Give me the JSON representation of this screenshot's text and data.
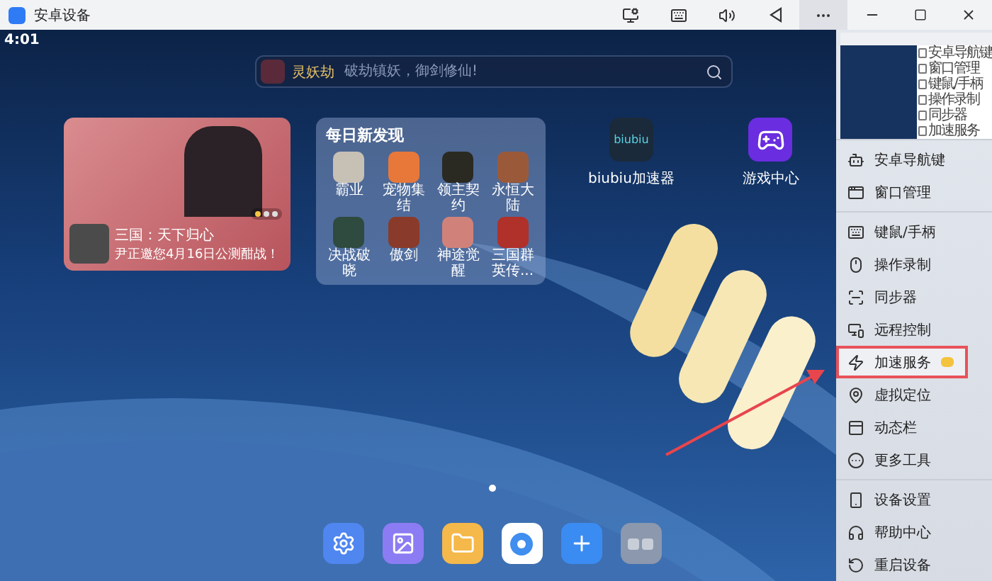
{
  "window": {
    "title": "安卓设备",
    "toolbar": [
      {
        "kind": "screen",
        "selected": false
      },
      {
        "kind": "keyboard",
        "selected": false
      },
      {
        "kind": "volume",
        "selected": false
      },
      {
        "kind": "back",
        "selected": false
      },
      {
        "kind": "more",
        "selected": true
      }
    ]
  },
  "status_bar": {
    "time": "4:01"
  },
  "search": {
    "game": "灵妖劫",
    "placeholder": "破劫镇妖，御剑修仙!"
  },
  "banner": {
    "title": "三国：天下归心",
    "subtitle": "尹正邀您4月16日公测酣战！",
    "dots": [
      {
        "selected": true
      },
      {
        "selected": false
      },
      {
        "selected": false
      }
    ]
  },
  "discover": {
    "title": "每日新发现",
    "games": [
      "霸业",
      "宠物集结",
      "领主契约",
      "永恒大陆",
      "决战破晓",
      "傲剑",
      "神途觉醒",
      "三国群英传..."
    ]
  },
  "apps": [
    {
      "kind": "biubiu",
      "logo_text": "biubiu",
      "label": "biubiu加速器"
    },
    {
      "kind": "games",
      "label": "游戏中心"
    }
  ],
  "page_indicator": [
    {
      "selected": true
    }
  ],
  "dock": [
    {
      "kind": "settings"
    },
    {
      "kind": "gallery"
    },
    {
      "kind": "files"
    },
    {
      "kind": "browser"
    },
    {
      "kind": "store"
    },
    {
      "kind": "folder"
    }
  ],
  "preview": {
    "menu": [
      "安卓导航键",
      "窗口管理",
      "键鼠/手柄",
      "操作录制",
      "同步器",
      "加速服务"
    ]
  },
  "menu_groups": [
    {
      "items": [
        {
          "label": "安卓导航键",
          "selected": false
        },
        {
          "label": "窗口管理",
          "selected": false
        }
      ]
    },
    {
      "items": [
        {
          "label": "键鼠/手柄",
          "selected": false
        },
        {
          "label": "操作录制",
          "selected": false
        },
        {
          "label": "同步器",
          "selected": false
        },
        {
          "label": "远程控制",
          "selected": false
        },
        {
          "label": "加速服务",
          "selected": true,
          "badge": true
        },
        {
          "label": "虚拟定位",
          "selected": false
        },
        {
          "label": "动态栏",
          "selected": false
        },
        {
          "label": "更多工具",
          "selected": false
        }
      ]
    },
    {
      "items": [
        {
          "label": "设备设置",
          "selected": false
        },
        {
          "label": "帮助中心",
          "selected": false
        },
        {
          "label": "重启设备",
          "selected": false
        }
      ]
    }
  ]
}
